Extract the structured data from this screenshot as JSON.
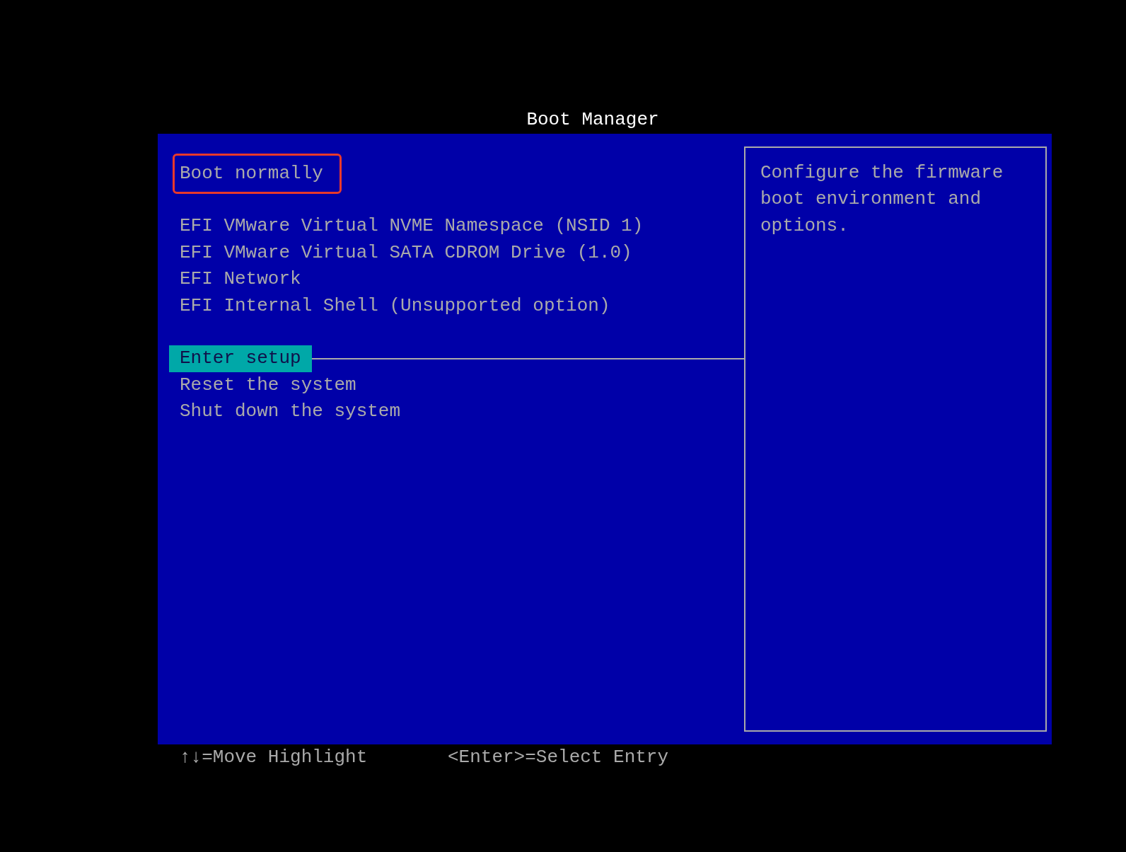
{
  "title": "Boot Manager",
  "menu_groups": [
    [
      {
        "label": "Boot normally",
        "selected": false,
        "annotated": true
      }
    ],
    [
      {
        "label": "EFI VMware Virtual NVME Namespace (NSID 1)",
        "selected": false,
        "annotated": false
      },
      {
        "label": "EFI VMware Virtual SATA CDROM Drive (1.0)",
        "selected": false,
        "annotated": false
      },
      {
        "label": "EFI Network",
        "selected": false,
        "annotated": false
      },
      {
        "label": "EFI Internal Shell (Unsupported option)",
        "selected": false,
        "annotated": false
      }
    ],
    [
      {
        "label": "Enter setup",
        "selected": true,
        "annotated": false
      },
      {
        "label": "Reset the system",
        "selected": false,
        "annotated": false
      },
      {
        "label": "Shut down the system",
        "selected": false,
        "annotated": false
      }
    ]
  ],
  "description": "Configure the firmware boot environment and options.",
  "footer_hints": [
    "↑↓=Move Highlight",
    "<Enter>=Select Entry"
  ]
}
